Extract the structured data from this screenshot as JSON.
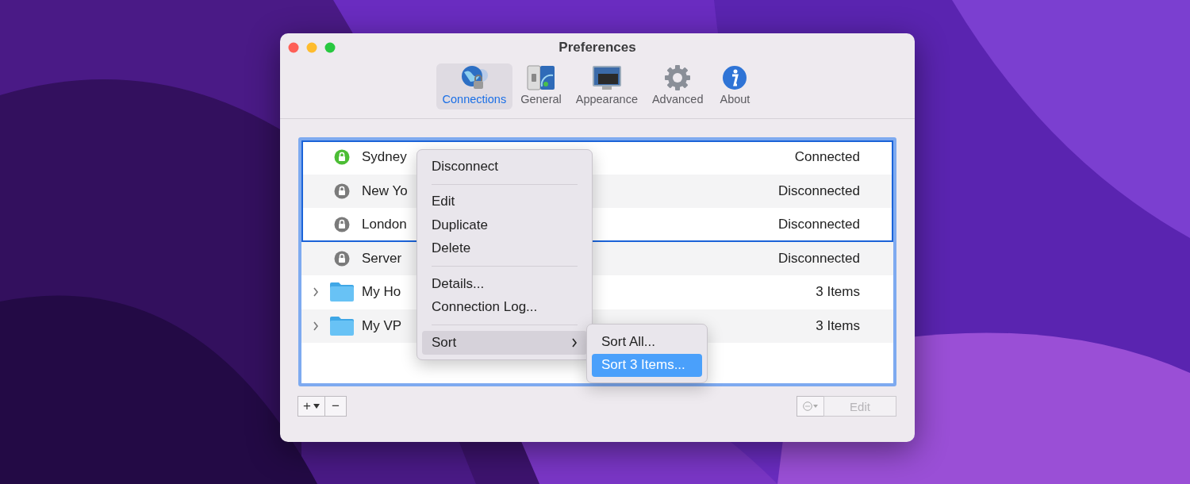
{
  "window": {
    "title": "Preferences"
  },
  "toolbar": [
    {
      "label": "Connections",
      "kind": "globe",
      "selected": true
    },
    {
      "label": "General",
      "kind": "switch",
      "selected": false
    },
    {
      "label": "Appearance",
      "kind": "monitor",
      "selected": false
    },
    {
      "label": "Advanced",
      "kind": "gear",
      "selected": false
    },
    {
      "label": "About",
      "kind": "info",
      "selected": false
    }
  ],
  "connections": [
    {
      "kind": "connection",
      "name": "Sydney",
      "status": "Connected",
      "connected": true,
      "selected": true
    },
    {
      "kind": "connection",
      "name": "New Yo",
      "status": "Disconnected",
      "connected": false,
      "selected": true
    },
    {
      "kind": "connection",
      "name": "London",
      "status": "Disconnected",
      "connected": false,
      "selected": true
    },
    {
      "kind": "connection",
      "name": "Server",
      "status": "Disconnected",
      "connected": false,
      "selected": false
    },
    {
      "kind": "folder",
      "name": "My Ho",
      "status": "3 Items",
      "expanded": false,
      "selected": false
    },
    {
      "kind": "folder",
      "name": "My VP",
      "status": "3 Items",
      "expanded": false,
      "selected": false
    }
  ],
  "context_menu": {
    "items": [
      {
        "kind": "item",
        "label": "Disconnect",
        "selected": false
      },
      {
        "kind": "separator"
      },
      {
        "kind": "item",
        "label": "Edit",
        "selected": false
      },
      {
        "kind": "item",
        "label": "Duplicate",
        "selected": false
      },
      {
        "kind": "item",
        "label": "Delete",
        "selected": false
      },
      {
        "kind": "separator"
      },
      {
        "kind": "item",
        "label": "Details...",
        "selected": false
      },
      {
        "kind": "item",
        "label": "Connection Log...",
        "selected": false
      },
      {
        "kind": "separator"
      },
      {
        "kind": "submenu",
        "label": "Sort",
        "selected": true
      }
    ]
  },
  "submenu": {
    "items": [
      {
        "label": "Sort All...",
        "selected": false
      },
      {
        "label": "Sort 3 Items...",
        "selected": true
      }
    ]
  },
  "bottom_bar": {
    "add_label": "+",
    "remove_label": "−",
    "edit_button": {
      "label": "Edit",
      "disabled": true
    }
  }
}
